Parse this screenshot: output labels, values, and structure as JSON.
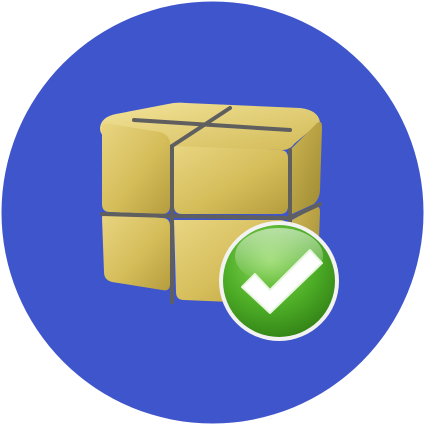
{
  "icon": {
    "name": "package-installed-icon",
    "depicts": [
      "package-box-icon",
      "checkmark-icon"
    ],
    "colors": {
      "background_circle": "#3F55CB",
      "box_light": "#E6D27C",
      "box_mid": "#C9B24F",
      "box_dark": "#9E8A33",
      "strap": "#5F5F5F",
      "check_badge": "#3E9E1F",
      "check_badge_light": "#8BD65A",
      "check_mark": "#FFFFFF"
    }
  }
}
